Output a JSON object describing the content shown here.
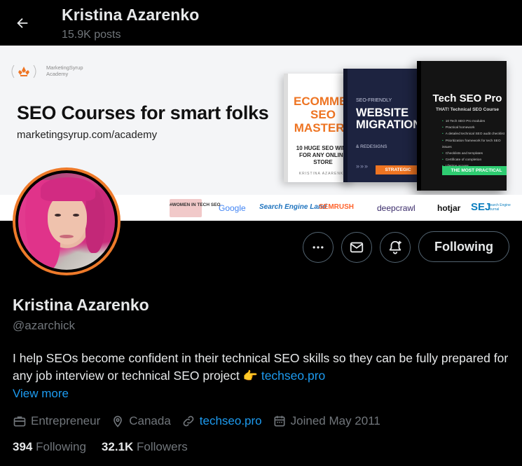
{
  "header": {
    "name": "Kristina Azarenko",
    "posts": "15.9K posts"
  },
  "banner": {
    "logo_text_line1": "MarketingSyrup",
    "logo_text_line2": "Academy",
    "title": "SEO Courses for smart folks",
    "url": "marketingsyrup.com/academy",
    "books": {
      "book1_title": "ECOMMERCE SEO MASTERY",
      "book1_sub": "10 HUGE SEO WINS FOR ANY ONLINE STORE",
      "book1_author": "KRISTINA AZARENKO",
      "book2_pre": "SEO-FRIENDLY",
      "book2_title": "WEBSITE MIGRATIONS",
      "book2_sub": "& REDESIGNS",
      "book2_tag": "STRATEGIC",
      "book3_title": "Tech SEO Pro",
      "book3_sub": "THAT! Technical SEO Course",
      "book3_list": [
        "10 Tech SEO Pro modules",
        "Practical homework",
        "A detailed technical SEO audit checklist",
        "Prioritization framework for tech SEO issues",
        "Checklists and templates",
        "Certificate of completion",
        "Lifetime access"
      ],
      "book3_tag": "THE MOST PRACTICAL"
    },
    "partners": {
      "women": "#WOMEN IN TECH SEO",
      "google": "Google",
      "sel": "Search Engine Land",
      "semrush": "SEMRUSH",
      "deepcrawl": "deepcrawl",
      "hotjar": "hotjar",
      "sej": "SEJ",
      "sej_small": "Search Engine Journal"
    }
  },
  "actions": {
    "follow_label": "Following"
  },
  "profile": {
    "name": "Kristina Azarenko",
    "handle": "@azarchick",
    "bio_text": "I help SEOs become confident in their technical SEO skills so they can be fully prepared for any job interview or technical SEO project",
    "bio_emoji": "👉",
    "bio_link": "techseo.pro",
    "view_more": "View more",
    "meta": {
      "category": "Entrepreneur",
      "location": "Canada",
      "website": "techseo.pro",
      "joined": "Joined May 2011"
    },
    "stats": {
      "following_count": "394",
      "following_label": "Following",
      "followers_count": "32.1K",
      "followers_label": "Followers"
    }
  },
  "colors": {
    "accent": "#1d9bf0",
    "secondary_text": "#71767b",
    "avatar_ring": "#ee7a2a"
  }
}
